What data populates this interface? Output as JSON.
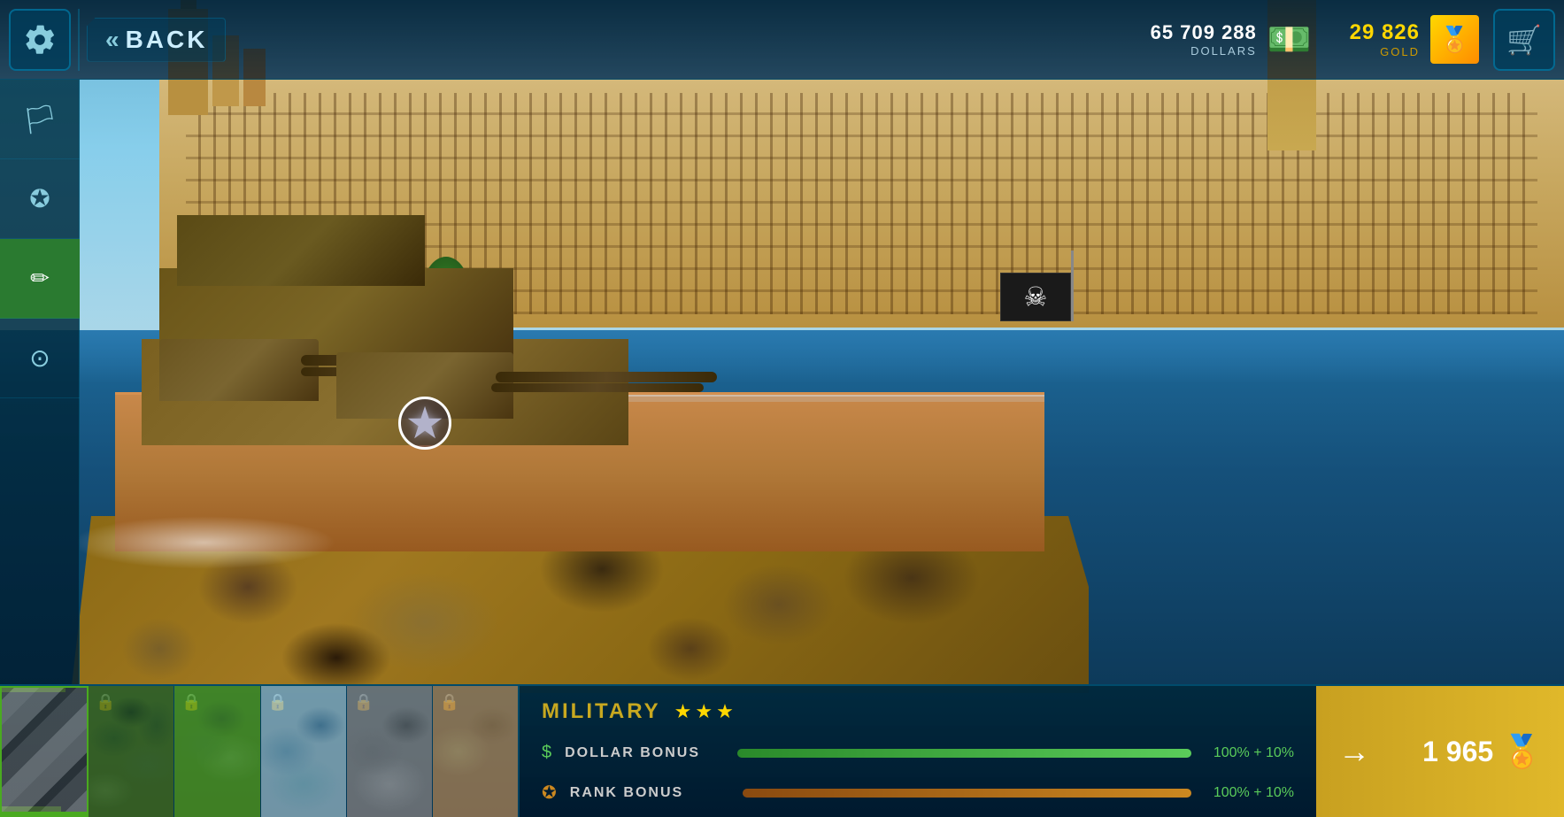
{
  "header": {
    "back_label": "BACK",
    "back_arrows": "«",
    "dollars_amount": "65 709 288",
    "dollars_label": "DOLLARS",
    "gold_amount": "29 826",
    "gold_label": "GOLD"
  },
  "sidebar": {
    "items": [
      {
        "id": "settings",
        "icon": "⚙",
        "label": "Settings"
      },
      {
        "id": "flag",
        "icon": "⚑",
        "label": "Flag"
      },
      {
        "id": "achievement",
        "icon": "✪",
        "label": "Achievement"
      },
      {
        "id": "customize",
        "icon": "✎",
        "label": "Customize",
        "active": true
      },
      {
        "id": "emblem",
        "icon": "◉",
        "label": "Emblem"
      }
    ]
  },
  "camo_tiles": [
    {
      "id": "military",
      "pattern": "military",
      "selected": true,
      "locked": false
    },
    {
      "id": "jungle",
      "pattern": "jungle",
      "selected": false,
      "locked": true
    },
    {
      "id": "jungle-bright",
      "pattern": "jungle-bright",
      "selected": false,
      "locked": true
    },
    {
      "id": "arctic",
      "pattern": "arctic",
      "selected": false,
      "locked": true
    },
    {
      "id": "gray",
      "pattern": "gray",
      "selected": false,
      "locked": true
    },
    {
      "id": "desert",
      "pattern": "desert",
      "selected": false,
      "locked": true
    }
  ],
  "selected_camo": {
    "name": "MILITARY",
    "stars": 3,
    "dollar_bonus_label": "DOLLAR BONUS",
    "dollar_bonus_value": "100%",
    "dollar_bonus_extra": "+ 10%",
    "dollar_bonus_pct": 100,
    "rank_bonus_label": "RANK BONUS",
    "rank_bonus_value": "100%",
    "rank_bonus_extra": "+ 10%",
    "rank_bonus_pct": 100
  },
  "buy": {
    "arrow": "→",
    "price": "1 965",
    "icon": "💰"
  },
  "icons": {
    "gear": "⚙",
    "back_arrow": "«",
    "flag": "⚑",
    "achievement": "✪",
    "customize": "✏",
    "emblem": "⊙",
    "lock": "🔒",
    "dollar": "$",
    "rank": "✪",
    "cart": "🛒",
    "gold_bar": "🏅",
    "money_pack": "💵"
  }
}
